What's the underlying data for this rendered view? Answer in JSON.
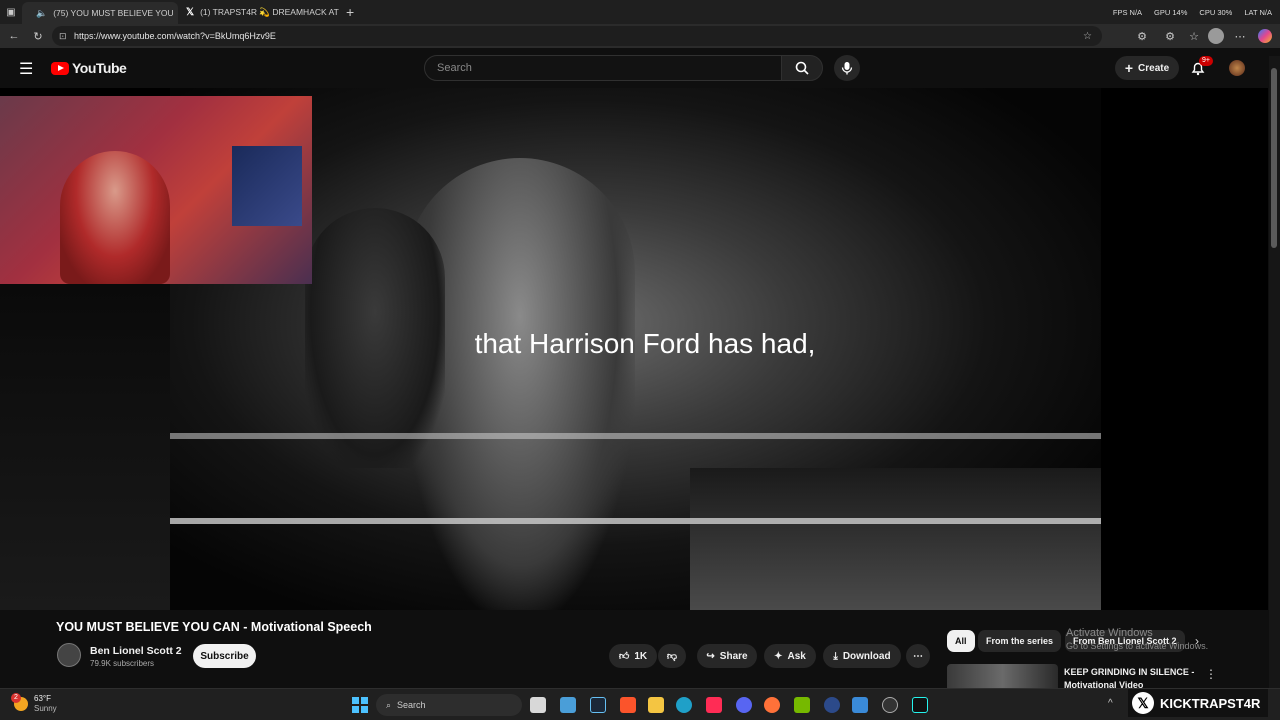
{
  "browser": {
    "tabs": [
      {
        "title": "(75) YOU MUST BELIEVE YOU",
        "active": true
      },
      {
        "title": "(1) TRAPST4R 💫 DREAMHACK AT",
        "active": false
      }
    ],
    "new_tab": "+",
    "stats": {
      "fps": "FPS N/A",
      "gpu": "GPU 14%",
      "cpu": "CPU 30%",
      "lat": "LAT N/A"
    },
    "url": "https://www.youtube.com/watch?v=BkUmq6Hzv9E"
  },
  "youtube": {
    "logo_text": "YouTube",
    "search_placeholder": "Search",
    "create_label": "Create",
    "notifications_badge": "9+"
  },
  "video": {
    "subtitle": "that Harrison Ford has had,",
    "title": "YOU MUST BELIEVE YOU CAN - Motivational Speech",
    "channel": "Ben Lionel Scott 2",
    "subscribers": "79.9K subscribers",
    "subscribe_label": "Subscribe",
    "likes": "1K",
    "share_label": "Share",
    "ask_label": "Ask",
    "download_label": "Download"
  },
  "sidebar_chips": [
    "All",
    "From the series",
    "From Ben Lionel Scott 2"
  ],
  "watermark": {
    "line1": "Activate Windows",
    "line2": "Go to Settings to activate Windows."
  },
  "recommendation": {
    "title": "KEEP GRINDING IN SILENCE - Motivational Video"
  },
  "taskbar": {
    "weather_temp": "63°F",
    "weather_desc": "Sunny",
    "weather_badge": "2",
    "search_label": "Search",
    "overlay_handle": "KICKTRAPST4R"
  },
  "colors": {
    "yt_red": "#ff0000",
    "bg": "#0f0f0f",
    "chip_bg": "#272727"
  }
}
